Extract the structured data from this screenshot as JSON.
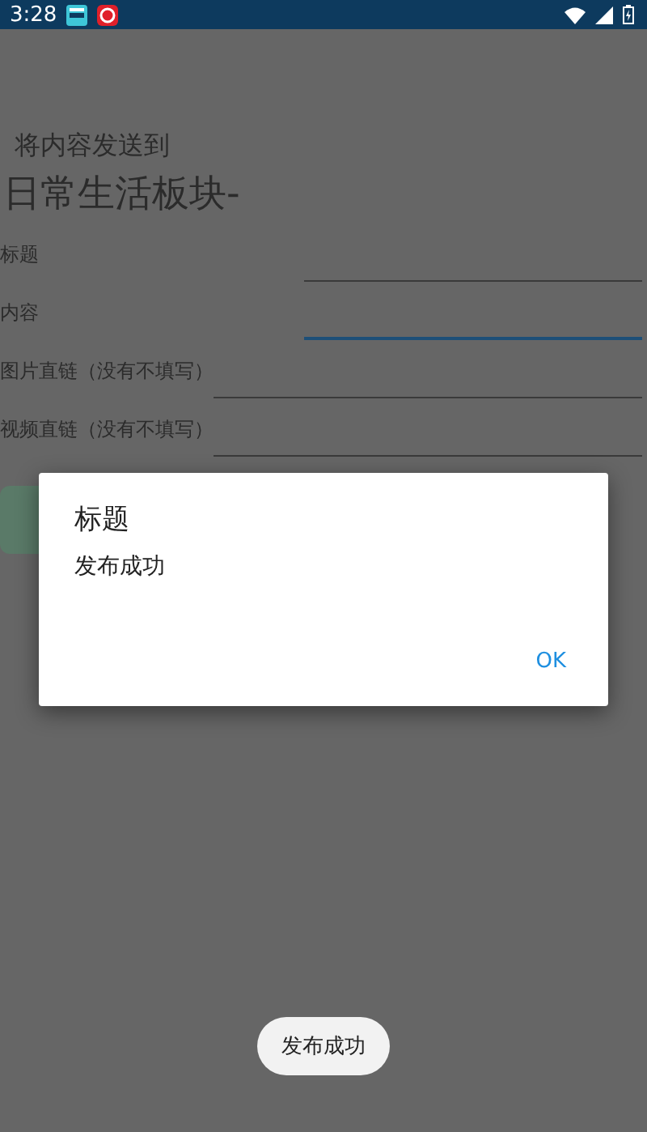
{
  "status_bar": {
    "time": "3:28"
  },
  "heading": "将内容发送到",
  "section": "日常生活板块-",
  "fields": [
    {
      "label": "标题",
      "focused": false
    },
    {
      "label": "内容",
      "focused": true
    },
    {
      "label": "图片直链（没有不填写）",
      "focused": false
    },
    {
      "label": "视频直链（没有不填写）",
      "focused": false
    }
  ],
  "dialog": {
    "title": "标题",
    "message": "发布成功",
    "buttons": [
      "OK"
    ]
  },
  "toast": "发布成功"
}
